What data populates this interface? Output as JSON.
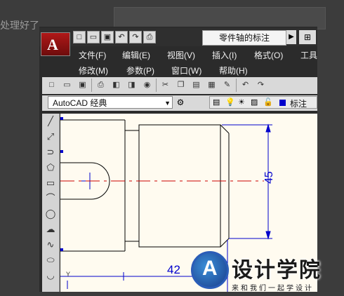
{
  "background": {
    "text": "处理好了"
  },
  "app": {
    "logo_letter": "A",
    "document_title": "零件轴的标注",
    "menus_row1": [
      "文件(F)",
      "编辑(E)",
      "视图(V)",
      "插入(I)",
      "格式(O)",
      "工具"
    ],
    "menus_row2": [
      "修改(M)",
      "参数(P)",
      "窗口(W)",
      "帮助(H)"
    ],
    "workspace": "AutoCAD 经典",
    "layer_name": "标注"
  },
  "drawing": {
    "dim_vertical": "45",
    "dim_horizontal": "42",
    "ucs_y": "Y",
    "center_color": "#cc0000",
    "dim_color": "#0000cc"
  },
  "watermark": {
    "title": "设计学院",
    "subtitle": "来和我们一起学设计"
  }
}
